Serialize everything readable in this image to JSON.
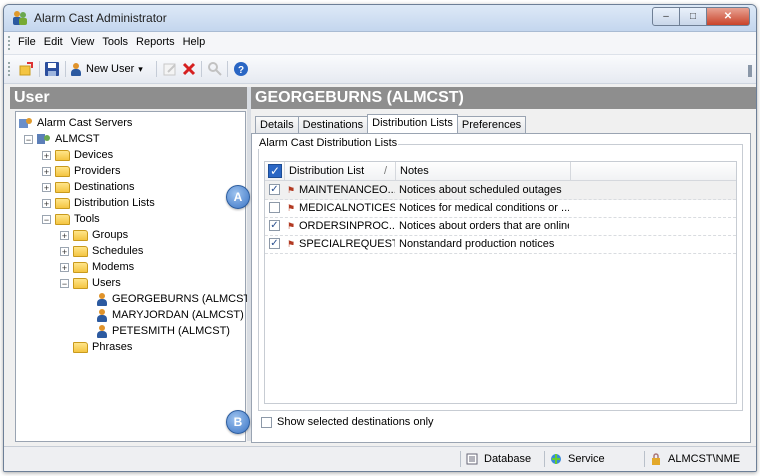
{
  "window": {
    "title": "Alarm Cast Administrator",
    "buttons": [
      "–",
      "□",
      "✕"
    ]
  },
  "menu": {
    "items": [
      "File",
      "Edit",
      "View",
      "Tools",
      "Reports",
      "Help"
    ]
  },
  "toolbar": {
    "new_user_label": "New User",
    "dropdown_arrow": "▾"
  },
  "left_header": "User",
  "right_header": "GEORGEBURNS (ALMCST)",
  "tree": {
    "root": "Alarm Cast Servers",
    "server": "ALMCST",
    "nodes": [
      "Devices",
      "Providers",
      "Destinations",
      "Distribution Lists",
      "Tools"
    ],
    "tools_children": [
      "Groups",
      "Schedules",
      "Modems",
      "Users"
    ],
    "users": [
      "GEORGEBURNS (ALMCST)",
      "MARYJORDAN (ALMCST)",
      "PETESMITH (ALMCST)"
    ],
    "phrases": "Phrases",
    "expander_plus": "+",
    "expander_minus": "−"
  },
  "tabs": [
    "Details",
    "Destinations",
    "Distribution Lists",
    "Preferences"
  ],
  "active_tab": "Distribution Lists",
  "group_label": "Alarm Cast Distribution Lists",
  "grid": {
    "columns": [
      "Distribution List",
      "Notes"
    ],
    "sort_indicator": "/",
    "rows": [
      {
        "checked": true,
        "name": "MAINTENANCEO...",
        "notes": "Notices about scheduled outages"
      },
      {
        "checked": false,
        "name": "MEDICALNOTICES",
        "notes": "Notices for medical conditions or ..."
      },
      {
        "checked": true,
        "name": "ORDERSINPROC...",
        "notes": "Notices about orders that are online"
      },
      {
        "checked": true,
        "name": "SPECIALREQUESTS",
        "notes": "Nonstandard production notices"
      }
    ]
  },
  "callouts": {
    "a": "A",
    "b": "B"
  },
  "show_selected_label": "Show selected destinations only",
  "status": {
    "database": "Database",
    "service": "Service",
    "user": "ALMCST\\NME"
  },
  "colors": {
    "header_bg": "#8e8e8e",
    "accent": "#2a66c4",
    "callout": "#3a74c5"
  }
}
